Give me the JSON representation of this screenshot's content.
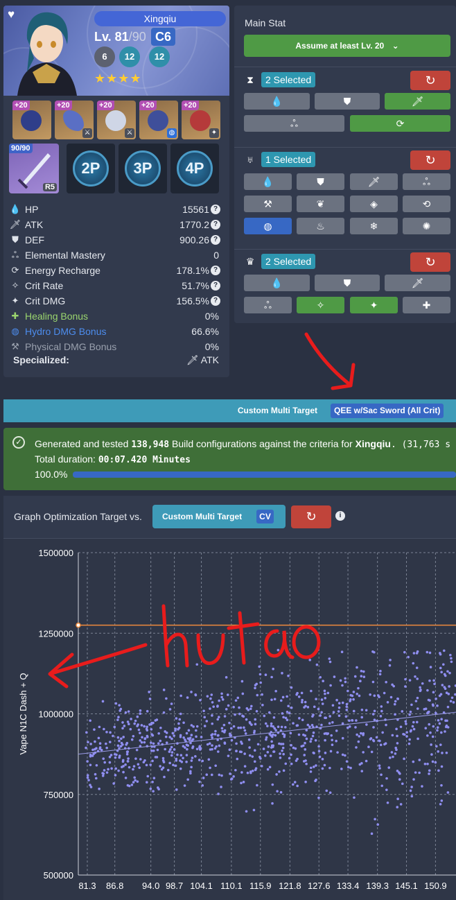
{
  "character": {
    "name": "Xingqiu",
    "level": "Lv. 81",
    "max_level": "/90",
    "constellation": "C6",
    "talents": [
      "6",
      "12",
      "12"
    ],
    "stars": "★★★★",
    "artifact_levels": [
      "+20",
      "+20",
      "+20",
      "+20",
      "+20"
    ],
    "weapon_level": "90/90",
    "weapon_refinement": "R5",
    "set_slots": [
      "2P",
      "3P",
      "4P"
    ]
  },
  "stats": [
    {
      "icon": "hp-icon",
      "name": "HP",
      "value": "15561",
      "help": true
    },
    {
      "icon": "atk-icon",
      "name": "ATK",
      "value": "1770.2",
      "help": true
    },
    {
      "icon": "def-icon",
      "name": "DEF",
      "value": "900.26",
      "help": true
    },
    {
      "icon": "em-icon",
      "name": "Elemental Mastery",
      "value": "0",
      "help": false
    },
    {
      "icon": "er-icon",
      "name": "Energy Recharge",
      "value": "178.1%",
      "help": true
    },
    {
      "icon": "crit-rate-icon",
      "name": "Crit Rate",
      "value": "51.7%",
      "help": true
    },
    {
      "icon": "crit-dmg-icon",
      "name": "Crit DMG",
      "value": "156.5%",
      "help": true
    },
    {
      "icon": "healing-icon",
      "name": "Healing Bonus",
      "value": "0%",
      "help": false,
      "color": "#9bd56e"
    },
    {
      "icon": "hydro-icon",
      "name": "Hydro DMG Bonus",
      "value": "66.6%",
      "help": false,
      "color": "#4d8dee"
    },
    {
      "icon": "physical-icon",
      "name": "Physical DMG Bonus",
      "value": "0%",
      "help": false,
      "color": "#9aa1ae"
    }
  ],
  "specialized": {
    "label": "Specialized:",
    "value": "ATK"
  },
  "main_stat": {
    "title": "Main Stat",
    "assume_button": "Assume at least Lv. 20",
    "sands_selected": "2 Selected",
    "goblet_selected": "1 Selected",
    "circlet_selected": "2 Selected"
  },
  "target_bar": {
    "label": "Custom Multi Target",
    "value": "QEE w/Sac Sword (All Crit)"
  },
  "generation": {
    "prefix": "Generated and tested ",
    "count": "138,948",
    "middle": " Build configurations against the criteria for ",
    "character": "Xingqiu",
    "suffix": ". (31,763 s",
    "duration_label": "Total duration: ",
    "duration": "00:07.420 Minutes",
    "progress": "100.0%",
    "progress_fraction": 1.0
  },
  "graph_header": {
    "label": "Graph Optimization Target vs.",
    "button": "Custom Multi Target",
    "badge": "CV"
  },
  "colors": {
    "accent_blue": "#3768c4",
    "teal": "#3e9bb8",
    "green": "#4f9a45",
    "red": "#c0443a",
    "point": "#8f8ef0",
    "threshold": "#f08a3c"
  },
  "chart_data": {
    "type": "scatter",
    "ylabel": "Vape N1C Dash + Q",
    "xlabel": "",
    "ylim": [
      500000,
      1500000
    ],
    "yticks": [
      "1500000",
      "1250000",
      "1000000",
      "750000",
      "500000"
    ],
    "xlim": [
      79.5,
      155
    ],
    "xticks": [
      "81.3",
      "86.8",
      "94.0",
      "98.7",
      "104.1",
      "110.1",
      "115.9",
      "121.8",
      "127.6",
      "133.4",
      "139.3",
      "145.1",
      "150.9"
    ],
    "xtick_values": [
      81.3,
      86.8,
      94.0,
      98.7,
      104.1,
      110.1,
      115.9,
      121.8,
      127.6,
      133.4,
      139.3,
      145.1,
      150.9
    ],
    "threshold_y": 1275000,
    "trend": {
      "x": [
        79.5,
        155
      ],
      "y": [
        875000,
        1005000
      ]
    },
    "point_count": 900,
    "grid": true
  },
  "annotations": {
    "handwritten_text": "hu tao"
  }
}
